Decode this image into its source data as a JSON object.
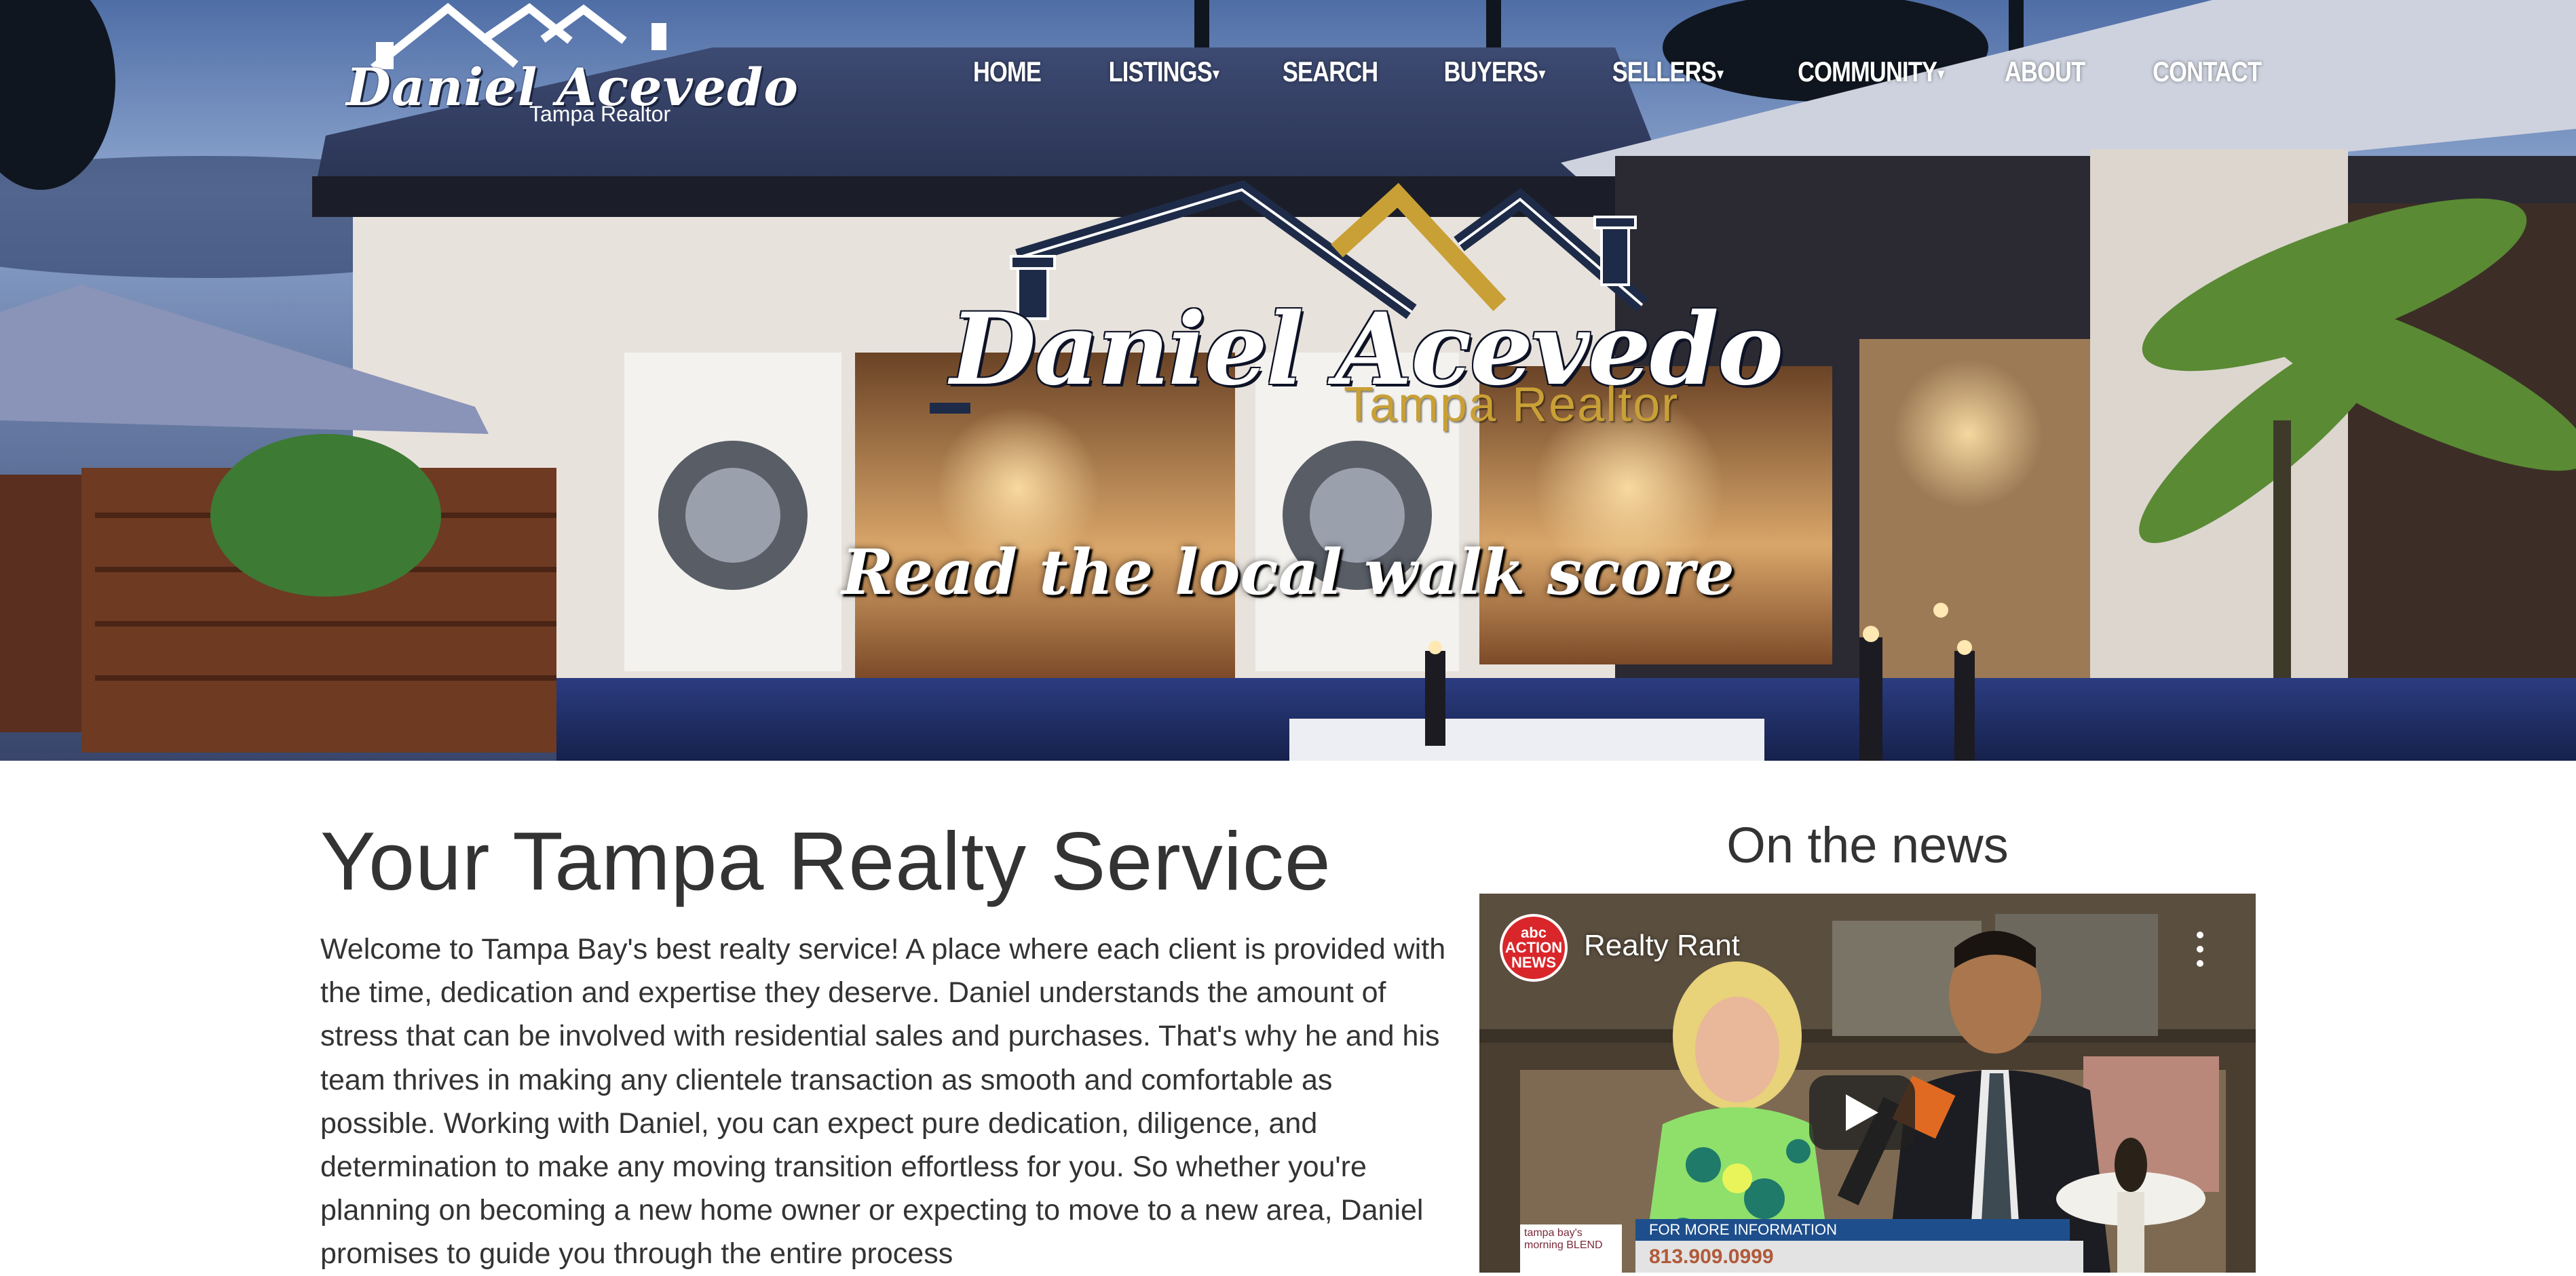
{
  "brand": {
    "name": "Daniel Acevedo",
    "subtitle": "Tampa Realtor"
  },
  "nav": {
    "items": [
      {
        "label": "HOME",
        "has_dropdown": false
      },
      {
        "label": "LISTINGS",
        "has_dropdown": true
      },
      {
        "label": "SEARCH",
        "has_dropdown": false
      },
      {
        "label": "BUYERS",
        "has_dropdown": true
      },
      {
        "label": "SELLERS",
        "has_dropdown": true
      },
      {
        "label": "COMMUNITY",
        "has_dropdown": true
      },
      {
        "label": "ABOUT",
        "has_dropdown": false
      },
      {
        "label": "CONTACT",
        "has_dropdown": false
      }
    ]
  },
  "hero": {
    "logo_name": "Daniel Acevedo",
    "logo_subtitle": "Tampa Realtor",
    "tagline": "Read the local walk score"
  },
  "main": {
    "title": "Your Tampa Realty Service",
    "intro": "Welcome to Tampa Bay's best realty service! A place where each client is provided with the time, dedication and expertise they deserve. Daniel understands the amount of stress that can be involved with residential sales and purchases. That's why he and his team thrives in making any clientele transaction as smooth and comfortable as possible. Working with Daniel, you can expect pure dedication, diligence, and determination to make any moving transition effortless for you. So whether you're planning on becoming a new home owner or expecting to move to a new area, Daniel promises to guide you through the entire process"
  },
  "news": {
    "heading": "On the news",
    "video": {
      "channel_badge": "abc ACTION NEWS",
      "title": "Realty Rant",
      "lower_third": "FOR MORE INFORMATION",
      "phone": "813.909.0999",
      "station_tag": "tampa bay's morning BLEND"
    }
  },
  "colors": {
    "text": "#333333",
    "accent_gold": "#c9a036",
    "logo_navy": "#1e2b48",
    "nav_text": "#ffffff"
  }
}
